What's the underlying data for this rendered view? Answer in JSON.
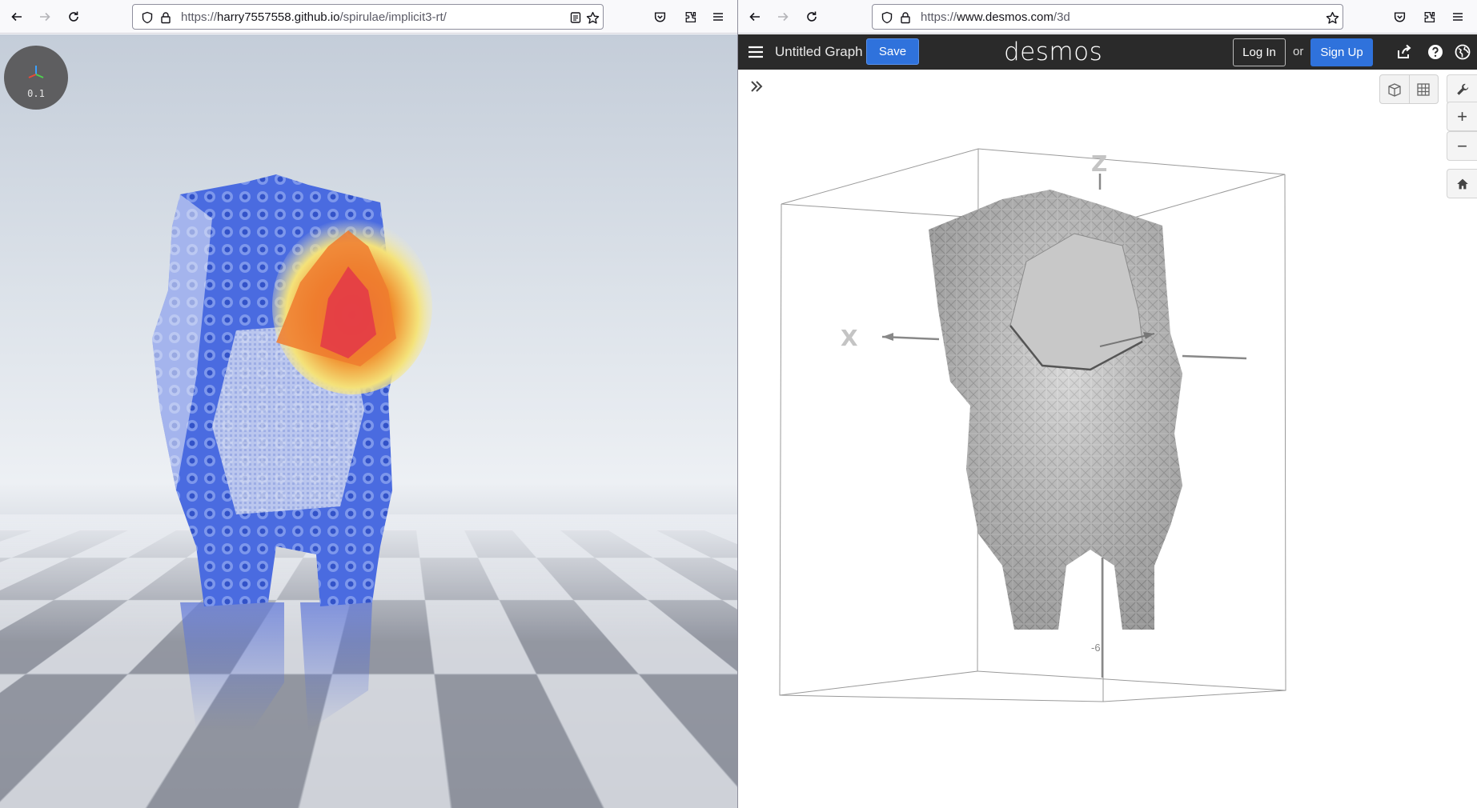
{
  "left_browser": {
    "url_prefix": "https://",
    "url_host": "harry7557558.github.io",
    "url_path": "/spirulae/implicit3-rt/"
  },
  "right_browser": {
    "url_prefix": "https://",
    "url_host": "www.desmos.com",
    "url_path": "/3d"
  },
  "left_app": {
    "gizmo_value": "0.1"
  },
  "desmos": {
    "graph_title": "Untitled Graph",
    "save_label": "Save",
    "logo_text": "desmos",
    "login_label": "Log In",
    "or_text": "or",
    "signup_label": "Sign Up",
    "zoom_in_label": "+",
    "zoom_out_label": "−",
    "axis_x_label": "X",
    "axis_z_label": "Z",
    "axis_tick_label": "-6"
  },
  "colors": {
    "desmos_header": "#2a2a2a",
    "desmos_blue": "#2f72dc",
    "fractal_blue": "#3a5ed8",
    "highlight_orange": "#f08a2a",
    "highlight_red": "#e2334a"
  }
}
